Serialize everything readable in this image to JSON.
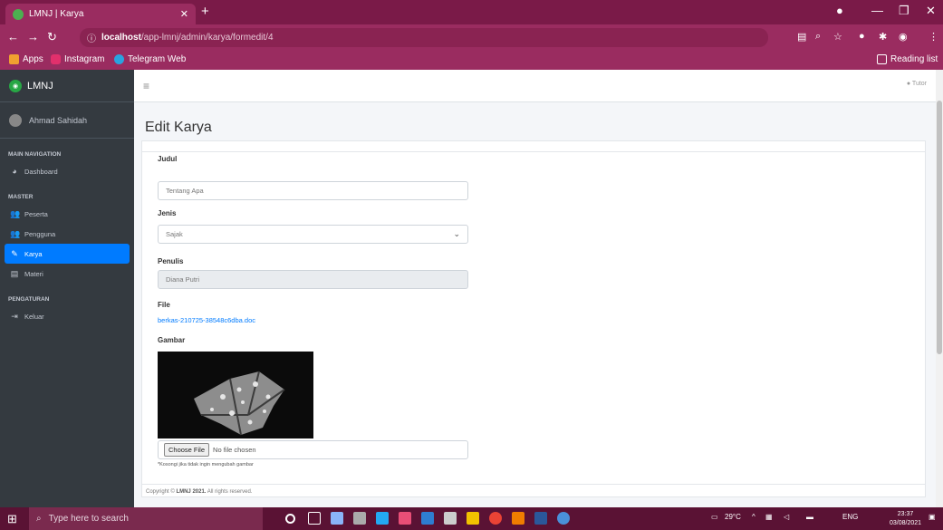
{
  "browser": {
    "tab_title": "LMNJ | Karya",
    "url_host": "localhost",
    "url_path": "/app-lmnj/admin/karya/formedit/4",
    "bookmarks": [
      "Apps",
      "Instagram",
      "Telegram Web"
    ],
    "reading_list": "Reading list"
  },
  "sidebar": {
    "brand": "LMNJ",
    "user": "Ahmad Sahidah",
    "sections": {
      "main": "MAIN NAVIGATION",
      "master": "MASTER",
      "pengaturan": "PENGATURAN"
    },
    "items": {
      "dashboard": "Dashboard",
      "peserta": "Peserta",
      "pengguna": "Pengguna",
      "karya": "Karya",
      "materi": "Materi",
      "keluar": "Keluar"
    }
  },
  "topnav": {
    "tutor": "Tutor"
  },
  "page": {
    "title": "Edit Karya"
  },
  "form": {
    "judul_label": "Judul",
    "judul_value": "Tentang Apa",
    "jenis_label": "Jenis",
    "jenis_value": "Sajak",
    "penulis_label": "Penulis",
    "penulis_value": "Diana Putri",
    "file_label": "File",
    "file_link": "berkas-210725-38548c6dba.doc",
    "gambar_label": "Gambar",
    "choose_file": "Choose File",
    "no_file": "No file chosen",
    "hint": "*Kosongi jika tidak ingin mengubah gambar"
  },
  "footer": {
    "prefix": "Copyright © ",
    "brand": "LMNJ 2021.",
    "suffix": " All rights reserved."
  },
  "taskbar": {
    "search_placeholder": "Type here to search",
    "weather": "29°C",
    "lang": "ENG",
    "time": "23:37",
    "date": "03/08/2021"
  },
  "colors": {
    "chrome": "#9a2c60",
    "sidebar": "#343a40",
    "active": "#007bff"
  }
}
